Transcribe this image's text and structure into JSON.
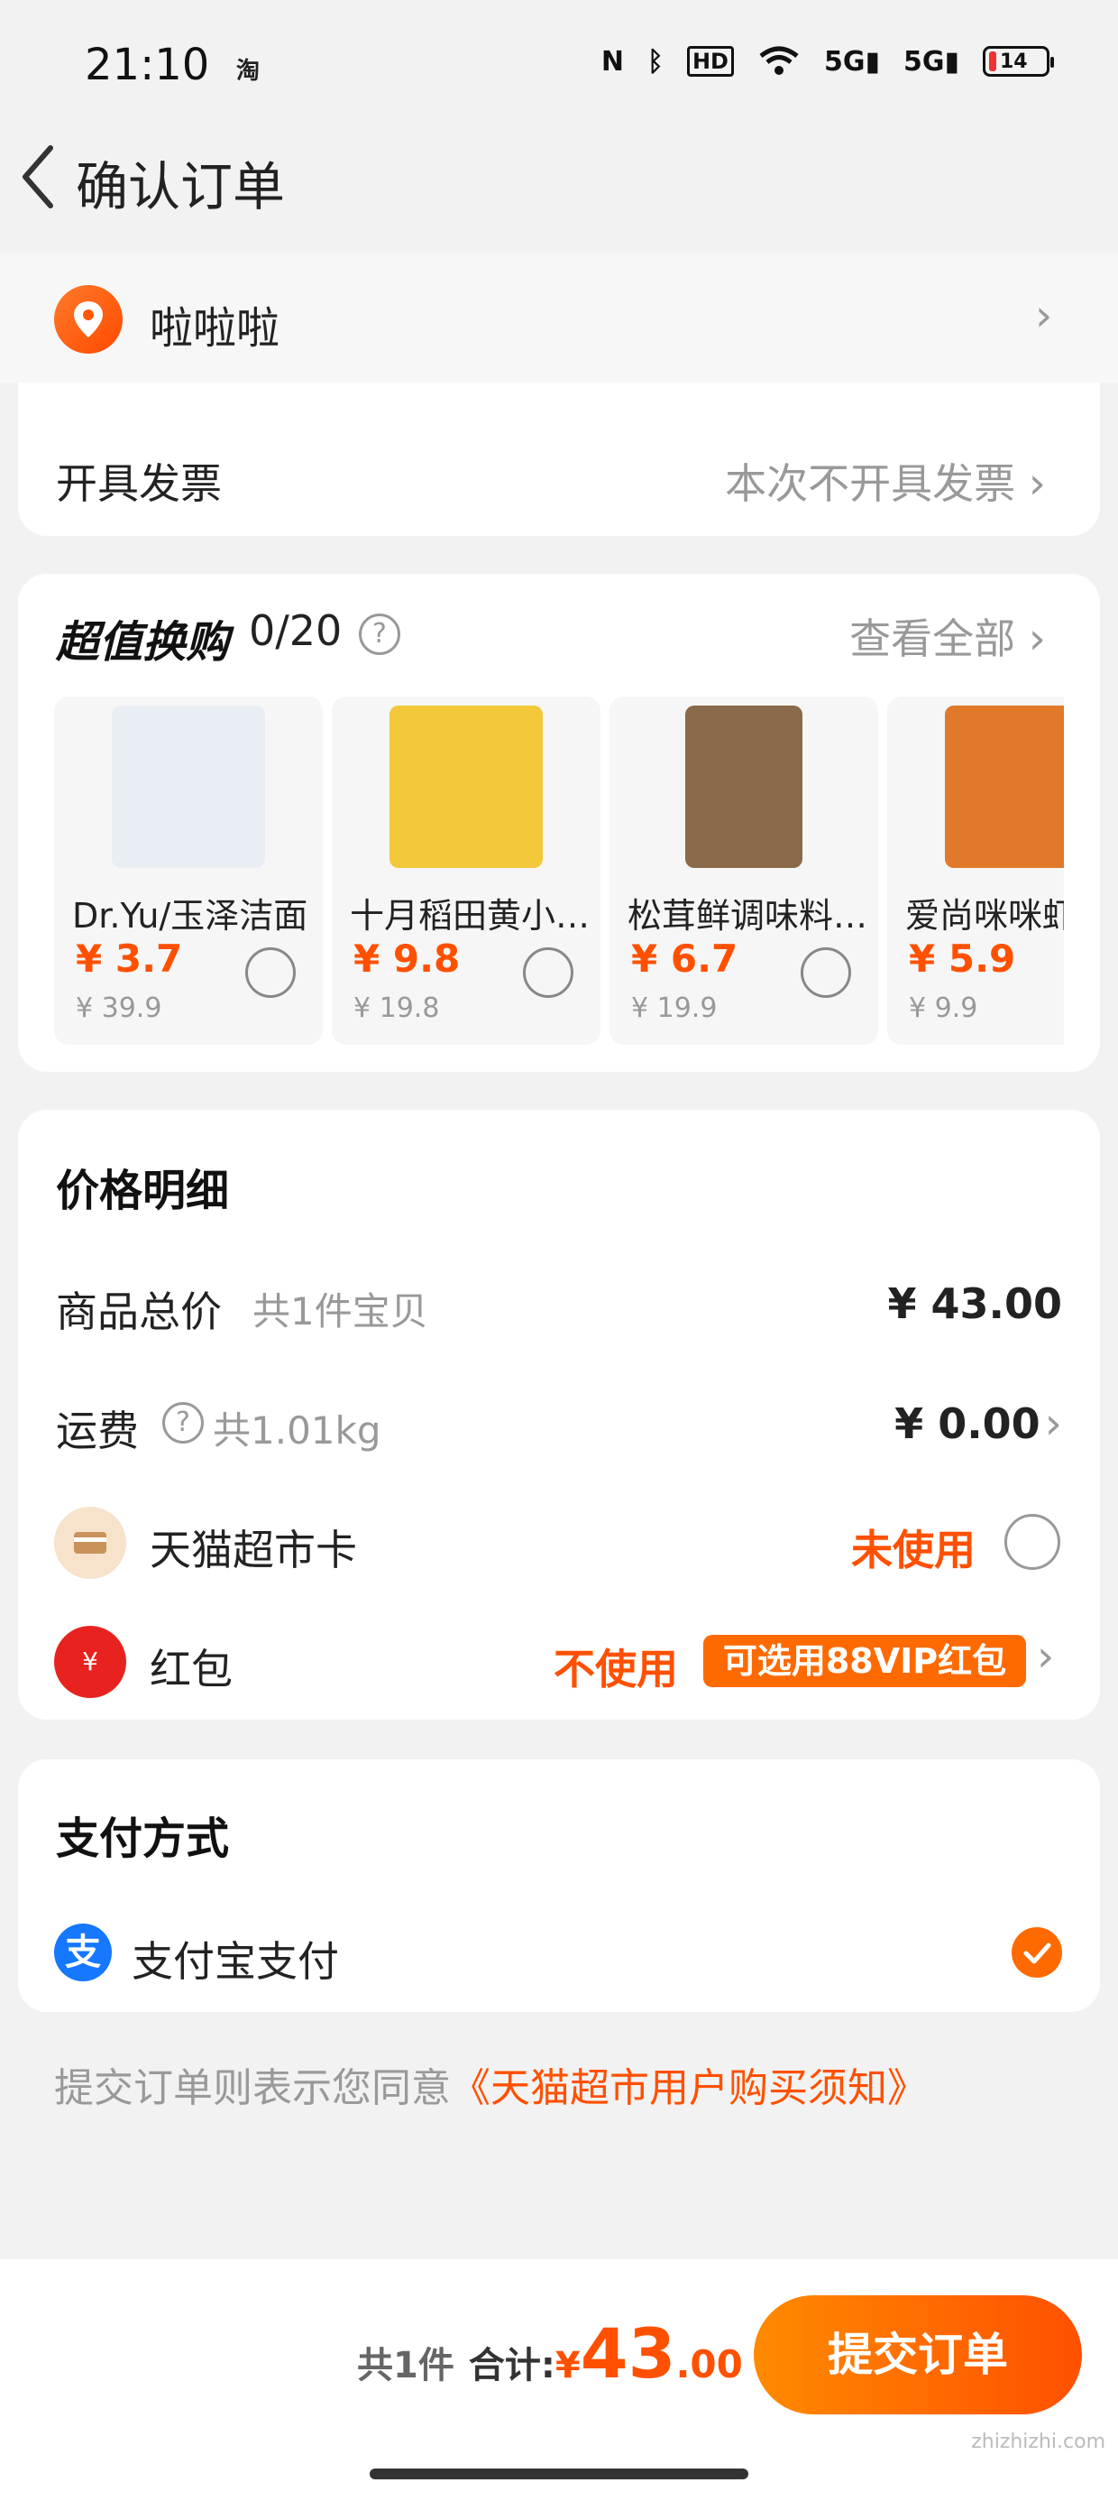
{
  "status_bar": {
    "time": "21:10",
    "app_icon": "淘",
    "icons": [
      "nfc-icon",
      "bluetooth-icon",
      "hd-icon",
      "wifi-icon",
      "5g-signal-icon",
      "5g-signal-icon"
    ],
    "battery": "14"
  },
  "header": {
    "title": "确认订单"
  },
  "address": {
    "name": "啦啦啦"
  },
  "invoice": {
    "label": "开具发票",
    "value": "本次不开具发票"
  },
  "deals": {
    "title": "超值换购",
    "count": "0/20",
    "view_all": "查看全部",
    "products": [
      {
        "name": "Dr.Yu/玉泽洁面",
        "price": "¥ 3.7",
        "orig": "¥ 39.9",
        "color": "#e9eef5"
      },
      {
        "name": "十月稻田黄小…",
        "price": "¥ 9.8",
        "orig": "¥ 19.8",
        "color": "#f3c83a"
      },
      {
        "name": "松茸鲜调味料…",
        "price": "¥ 6.7",
        "orig": "¥ 19.9",
        "color": "#8a6a4a"
      },
      {
        "name": "爱尚咪咪虾",
        "price": "¥ 5.9",
        "orig": "¥ 9.9",
        "color": "#e07a2a"
      }
    ]
  },
  "price": {
    "title": "价格明细",
    "goods_label": "商品总价",
    "goods_sub": "共1件宝贝",
    "goods_value": "¥ 43.00",
    "shipping_label": "运费",
    "shipping_sub": "共1.01kg",
    "shipping_value": "¥ 0.00",
    "card_label": "天猫超市卡",
    "card_value": "未使用",
    "redpacket_label": "红包",
    "redpacket_value": "不使用",
    "redpacket_badge": "可选用88VIP红包",
    "redpacket_symbol": "¥"
  },
  "payment": {
    "title": "支付方式",
    "method": "支付宝支付",
    "method_icon": "支"
  },
  "agreement": {
    "prefix": "提交订单则表示您同意",
    "link": "《天猫超市用户购买须知》"
  },
  "bottom": {
    "count": "共1件",
    "total_label": "合计:",
    "currency": "¥",
    "amount": "43",
    "decimal": ".00",
    "submit": "提交订单"
  },
  "watermark": "zhizhizhi.com",
  "colors": {
    "accent": "#ff5000",
    "alipay": "#1677ff"
  }
}
